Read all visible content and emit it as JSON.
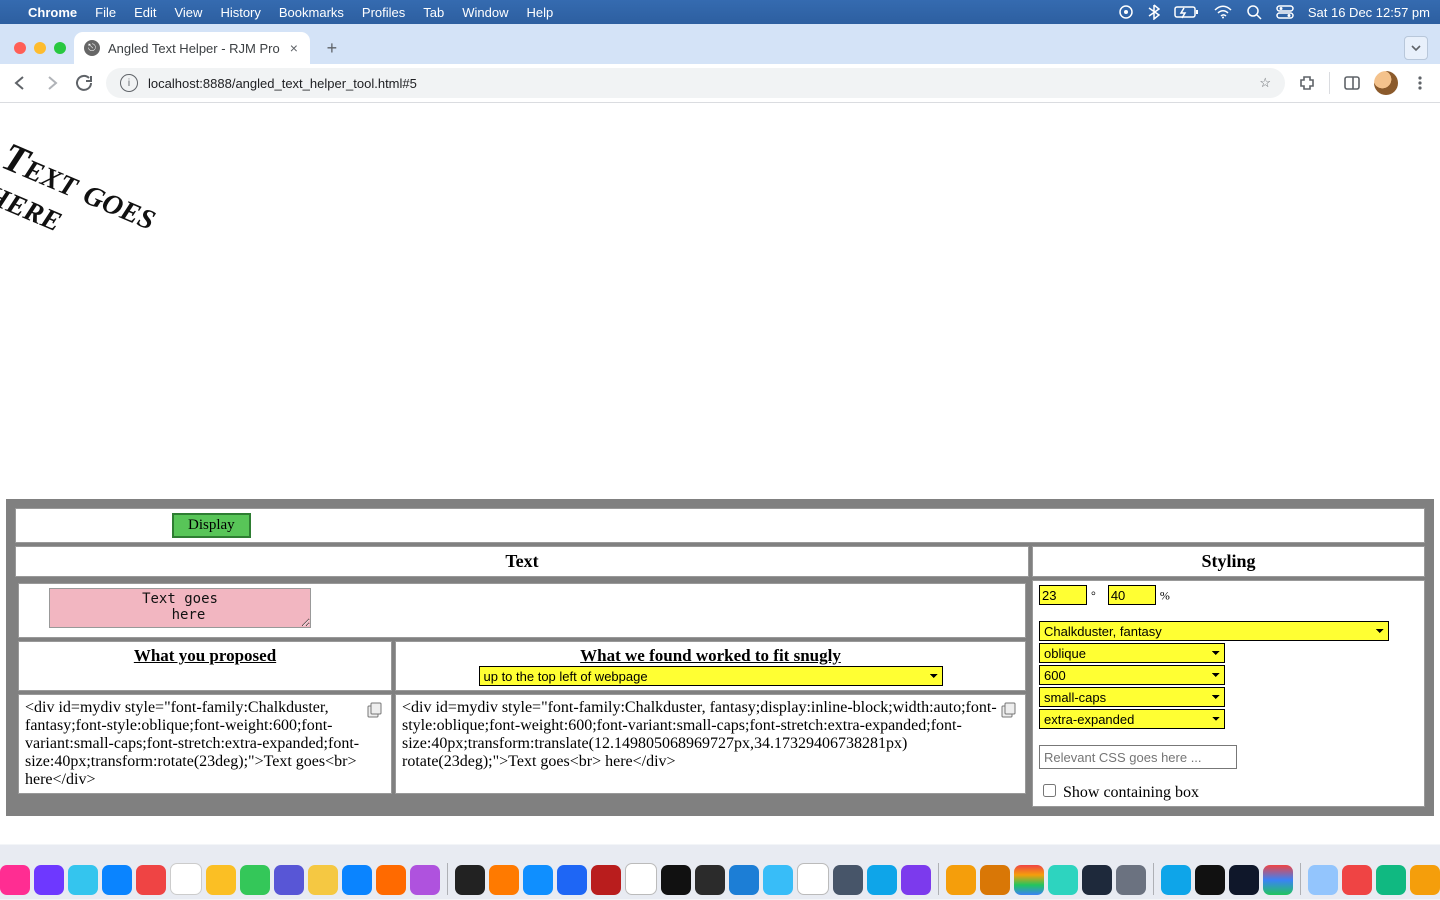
{
  "menubar": {
    "app": "Chrome",
    "items": [
      "File",
      "Edit",
      "View",
      "History",
      "Bookmarks",
      "Profiles",
      "Tab",
      "Window",
      "Help"
    ],
    "clock": "Sat 16 Dec  12:57 pm"
  },
  "tab": {
    "title": "Angled Text Helper - RJM Pro"
  },
  "omnibox": {
    "url": "localhost:8888/angled_text_helper_tool.html#5"
  },
  "preview": {
    "line1": "Text goes",
    "line2": "here"
  },
  "panel": {
    "display_button": "Display",
    "text_header": "Text",
    "styling_header": "Styling",
    "textarea_value": "Text goes\n  here",
    "proposed_header": "What you proposed",
    "found_header": "What we found worked to fit snugly",
    "snug_select": "up to the top left of webpage",
    "proposed_code": "<div id=mydiv style=\"font-family:Chalkduster, fantasy;font-style:oblique;font-weight:600;font-variant:small-caps;font-stretch:extra-expanded;font-size:40px;transform:rotate(23deg);\">Text goes<br> here</div>",
    "found_code": "<div id=mydiv style=\"font-family:Chalkduster, fantasy;display:inline-block;width:auto;font-style:oblique;font-weight:600;font-variant:small-caps;font-stretch:extra-expanded;font-size:40px;transform:translate(12.149805068969727px,34.17329406738281px) rotate(23deg);\">Text goes<br> here</div>",
    "angle": {
      "value": "23",
      "unit": "°"
    },
    "size": {
      "value": "40",
      "unit": "%"
    },
    "font_family": "Chalkduster, fantasy",
    "font_style": "oblique",
    "font_weight": "600",
    "font_variant": "small-caps",
    "font_stretch": "extra-expanded",
    "rel_css_placeholder": "Relevant CSS goes here ...",
    "show_box_label": "Show containing box"
  }
}
